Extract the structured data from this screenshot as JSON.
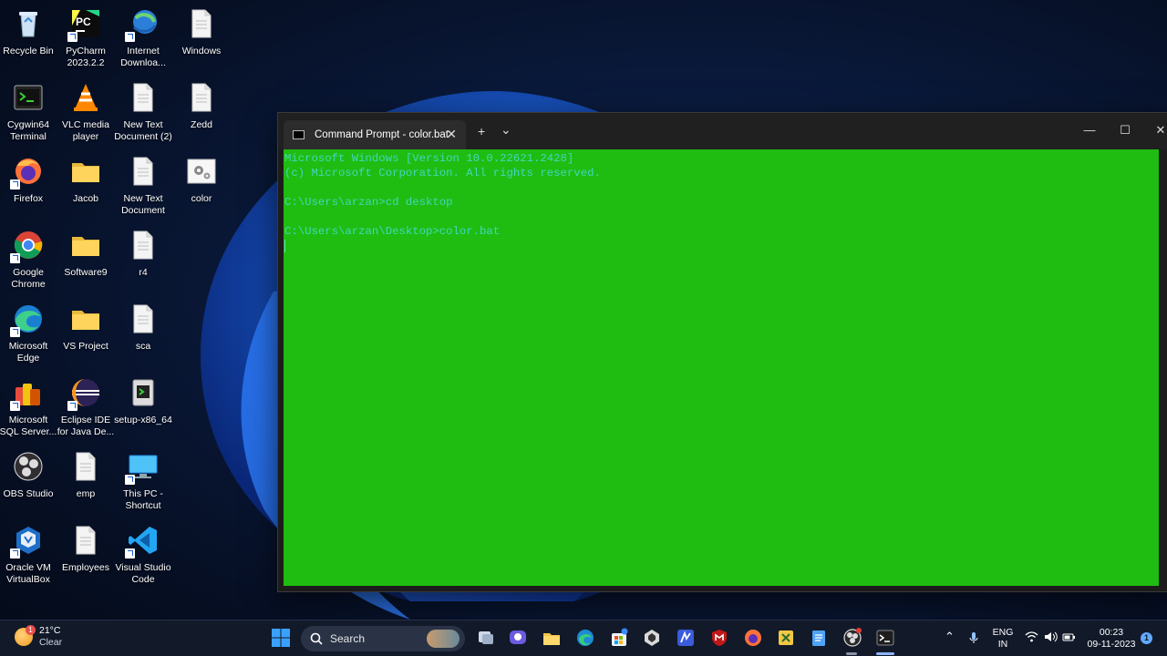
{
  "desktop": {
    "icons": [
      {
        "label": "Recycle Bin",
        "icon": "recycle-bin-icon"
      },
      {
        "label": "PyCharm 2023.2.2",
        "icon": "pycharm-icon"
      },
      {
        "label": "Internet Downloa...",
        "icon": "internet-download-manager-icon"
      },
      {
        "label": "Windows",
        "icon": "text-file-icon"
      },
      {
        "label": "Cygwin64 Terminal",
        "icon": "cygwin-icon"
      },
      {
        "label": "VLC media player",
        "icon": "vlc-icon"
      },
      {
        "label": "New Text Document (2)",
        "icon": "text-file-icon"
      },
      {
        "label": "Zedd",
        "icon": "text-file-icon"
      },
      {
        "label": "Firefox",
        "icon": "firefox-icon"
      },
      {
        "label": "Jacob",
        "icon": "folder-icon"
      },
      {
        "label": "New Text Document",
        "icon": "text-file-icon"
      },
      {
        "label": "color",
        "icon": "batch-file-icon"
      },
      {
        "label": "Google Chrome",
        "icon": "chrome-icon"
      },
      {
        "label": "Software9",
        "icon": "folder-icon"
      },
      {
        "label": "r4",
        "icon": "text-file-icon"
      },
      {
        "label": "Microsoft Edge",
        "icon": "edge-icon"
      },
      {
        "label": "VS Project",
        "icon": "folder-icon"
      },
      {
        "label": "sca",
        "icon": "text-file-icon"
      },
      {
        "label": "Microsoft SQL Server...",
        "icon": "sql-server-icon"
      },
      {
        "label": "Eclipse IDE for Java De...",
        "icon": "eclipse-icon"
      },
      {
        "label": "setup-x86_64",
        "icon": "setup-icon"
      },
      {
        "label": "OBS Studio",
        "icon": "obs-icon"
      },
      {
        "label": "emp",
        "icon": "text-file-icon"
      },
      {
        "label": "This PC - Shortcut",
        "icon": "this-pc-icon"
      },
      {
        "label": "Oracle VM VirtualBox",
        "icon": "virtualbox-icon"
      },
      {
        "label": "Employees",
        "icon": "text-file-icon"
      },
      {
        "label": "Visual Studio Code",
        "icon": "vscode-icon"
      }
    ]
  },
  "terminal": {
    "tab_title": "Command Prompt - color.bat",
    "tab_close": "✕",
    "new_tab": "+",
    "dropdown": "⌄",
    "minimize": "—",
    "maximize": "☐",
    "close": "✕",
    "background_color": "#1fbd12",
    "text_color": "#43d6bd",
    "lines": [
      "Microsoft Windows [Version 10.0.22621.2428]",
      "(c) Microsoft Corporation. All rights reserved.",
      "",
      "C:\\Users\\arzan>cd desktop",
      "",
      "C:\\Users\\arzan\\Desktop>color.bat"
    ]
  },
  "taskbar": {
    "weather_temp": "21°C",
    "weather_cond": "Clear",
    "weather_badge": "1",
    "search_placeholder": "Search",
    "language_line1": "ENG",
    "language_line2": "IN",
    "time": "00:23",
    "date": "09-11-2023",
    "notification_count": "1",
    "apps": [
      "start-icon",
      "search-icon",
      "task-view-icon",
      "teams-icon",
      "file-explorer-icon",
      "edge-icon",
      "microsoft-store-icon",
      "unity-icon",
      "app-icon",
      "mcafee-icon",
      "firefox-icon",
      "excel-icon",
      "notepad-icon",
      "obs-icon",
      "terminal-icon"
    ]
  }
}
